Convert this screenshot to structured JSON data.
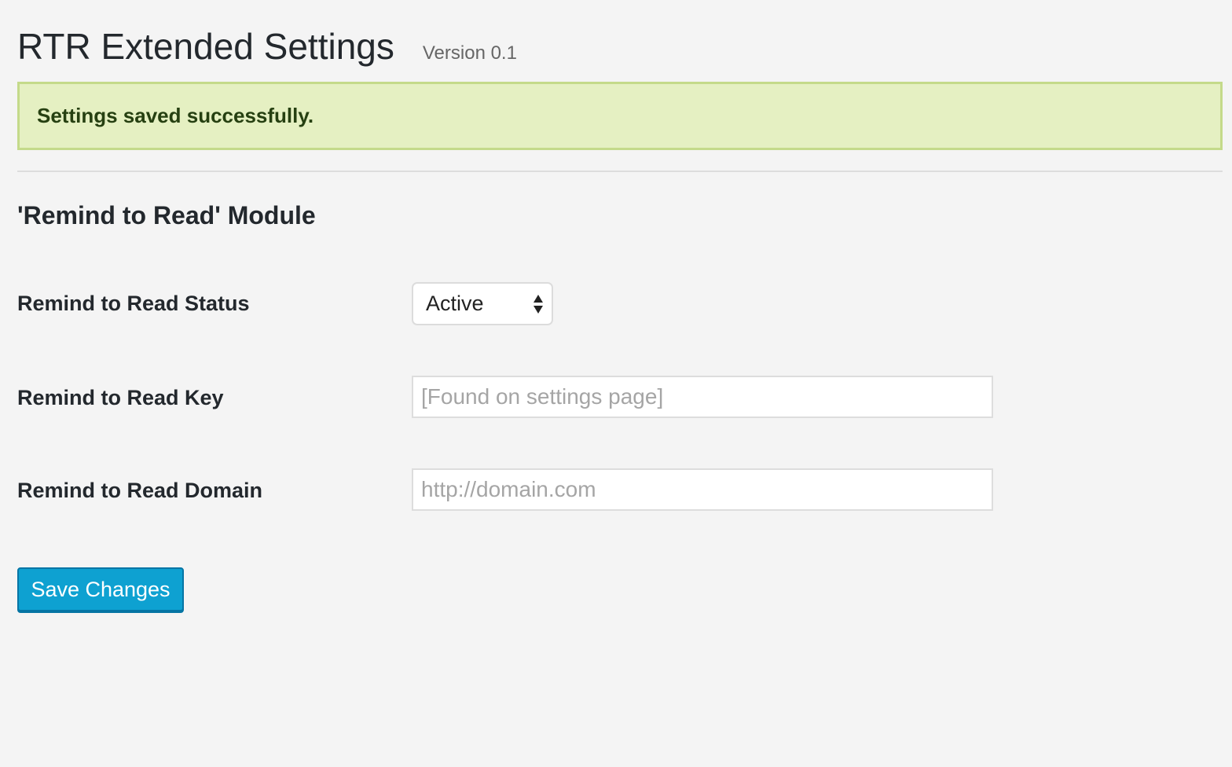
{
  "header": {
    "title": "RTR Extended Settings",
    "version": "Version 0.1"
  },
  "notice": {
    "message": "Settings saved successfully."
  },
  "section": {
    "title": "'Remind to Read' Module"
  },
  "fields": {
    "status": {
      "label": "Remind to Read Status",
      "selected": "Active"
    },
    "key": {
      "label": "Remind to Read Key",
      "value": "",
      "placeholder": "[Found on settings page]"
    },
    "domain": {
      "label": "Remind to Read Domain",
      "value": "",
      "placeholder": "http://domain.com"
    }
  },
  "actions": {
    "save_label": "Save Changes"
  },
  "icons": {
    "select_arrows": "up-down-arrows-icon"
  },
  "colors": {
    "notice_background": "#e5f0c2",
    "notice_border": "#c4da8a",
    "button_primary": "#0ea1d1"
  }
}
